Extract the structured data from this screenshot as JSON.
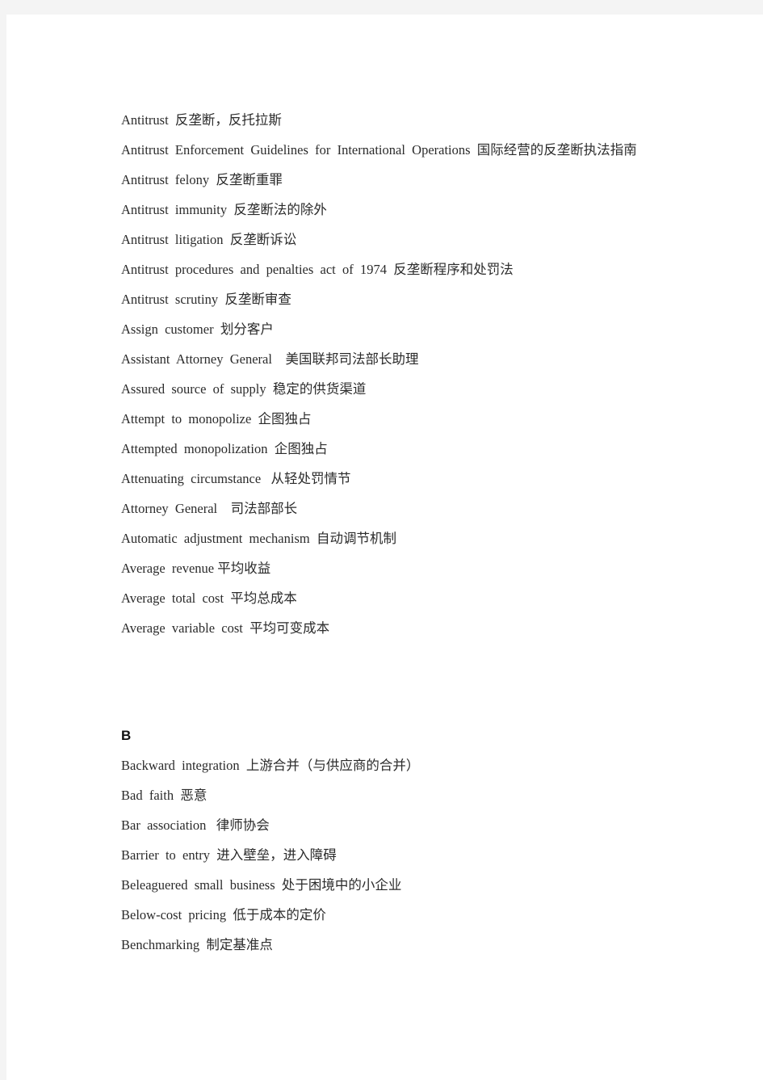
{
  "document": {
    "type": "glossary",
    "page_background": "#f4f4f4",
    "sheet_background": "#ffffff",
    "text_color": "#2b2b2b",
    "heading_color": "#111111",
    "sections": [
      {
        "heading": null,
        "heading_visible": false,
        "entries": [
          {
            "text": "Antitrust  反垄断，反托拉斯",
            "justified": false
          },
          {
            "text": "Antitrust  Enforcement  Guidelines  for  International  Operations  国际经营的反垄断执法指南",
            "justified": true
          },
          {
            "text": "Antitrust  felony  反垄断重罪",
            "justified": false
          },
          {
            "text": "Antitrust  immunity  反垄断法的除外",
            "justified": false
          },
          {
            "text": "Antitrust  litigation  反垄断诉讼",
            "justified": false
          },
          {
            "text": "Antitrust  procedures  and  penalties  act  of  1974  反垄断程序和处罚法",
            "justified": false
          },
          {
            "text": "Antitrust  scrutiny  反垄断审查",
            "justified": false
          },
          {
            "text": "Assign  customer  划分客户",
            "justified": false
          },
          {
            "text": "Assistant  Attorney  General    美国联邦司法部长助理",
            "justified": false
          },
          {
            "text": "Assured  source  of  supply  稳定的供货渠道",
            "justified": false
          },
          {
            "text": "Attempt  to  monopolize  企图独占",
            "justified": false
          },
          {
            "text": "Attempted  monopolization  企图独占",
            "justified": false
          },
          {
            "text": "Attenuating  circumstance   从轻处罚情节",
            "justified": false
          },
          {
            "text": "Attorney  General    司法部部长",
            "justified": false
          },
          {
            "text": "Automatic  adjustment  mechanism  自动调节机制",
            "justified": false
          },
          {
            "text": "Average  revenue 平均收益",
            "justified": false
          },
          {
            "text": "Average  total  cost  平均总成本",
            "justified": false
          },
          {
            "text": "Average  variable  cost  平均可变成本",
            "justified": false
          }
        ]
      },
      {
        "heading": "B",
        "heading_visible": true,
        "entries": [
          {
            "text": "Backward  integration  上游合并（与供应商的合并）",
            "justified": false
          },
          {
            "text": "Bad  faith  恶意",
            "justified": false
          },
          {
            "text": "Bar  association   律师协会",
            "justified": false
          },
          {
            "text": "Barrier  to  entry  进入壁垒，进入障碍",
            "justified": false
          },
          {
            "text": "Beleaguered  small  business  处于困境中的小企业",
            "justified": false
          },
          {
            "text": "Below-cost  pricing  低于成本的定价",
            "justified": false
          },
          {
            "text": "Benchmarking  制定基准点",
            "justified": false
          }
        ]
      }
    ]
  }
}
